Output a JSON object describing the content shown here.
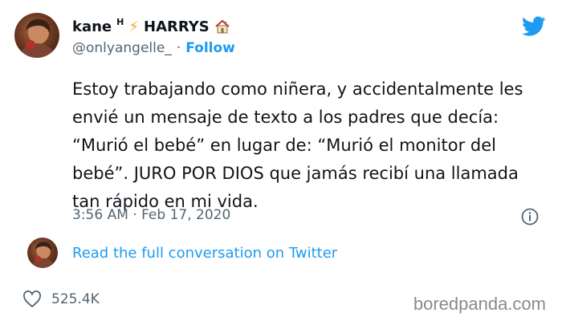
{
  "author": {
    "name": "kane",
    "name_superscript": "H",
    "name_emoji": "⚡",
    "name_suffix": "HARRYS",
    "handle": "@onlyangelle_",
    "separator": "·",
    "follow_label": "Follow"
  },
  "tweet": {
    "text": "Estoy trabajando como niñera, y accidentalmente les envié un mensaje de texto a los padres que decía: “Murió el bebé” en lugar de: “Murió el monitor del bebé”. JURO POR DIOS que jamás recibí una llamada tan rápido en mi vida.",
    "timestamp": "3:56 AM · Feb 17, 2020"
  },
  "conversation_link": "Read the full conversation on Twitter",
  "likes": "525.4K",
  "watermark": "boredpanda.com",
  "icons": {
    "brand": "twitter-bird-icon",
    "info": "info-icon",
    "like": "heart-icon",
    "house": "house-icon"
  },
  "colors": {
    "accent": "#1d9bf0",
    "muted": "#536471",
    "text": "#0f1419"
  }
}
